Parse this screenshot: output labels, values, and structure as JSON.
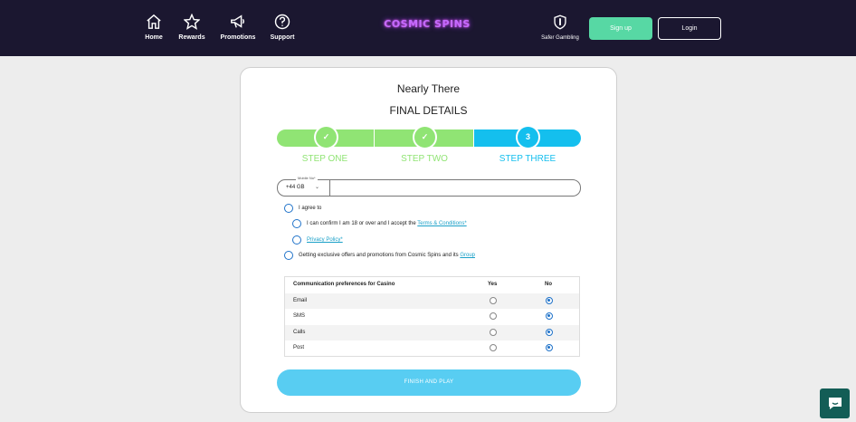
{
  "header": {
    "nav": [
      {
        "label": "Home",
        "icon": "home-icon"
      },
      {
        "label": "Rewards",
        "icon": "star-icon"
      },
      {
        "label": "Promotions",
        "icon": "megaphone-icon"
      },
      {
        "label": "Support",
        "icon": "question-icon"
      }
    ],
    "logo_text": "COSMIC SPINS",
    "safer_gambling": "Safer Gambling",
    "signup_label": "Sign up",
    "login_label": "Login"
  },
  "form": {
    "title": "Nearly There",
    "subtitle": "FINAL DETAILS",
    "steps": [
      {
        "label": "STEP ONE",
        "marker": "✓",
        "state": "done"
      },
      {
        "label": "STEP TWO",
        "marker": "✓",
        "state": "done"
      },
      {
        "label": "STEP THREE",
        "marker": "3",
        "state": "current"
      }
    ],
    "phone": {
      "float_label": "Mobile No*",
      "country_code": "+44 GB",
      "value": ""
    },
    "agree": {
      "label": "I agree to",
      "age_text": "I can confirm I am 18 or over and I accept the",
      "terms_link": "Terms & Conditions*",
      "privacy_link": "Privacy Policy*",
      "offers_text": "Getting exclusive offers and promotions from Cosmic Spins and its",
      "group_link": "Group"
    },
    "preferences": {
      "header": "Communication preferences for Casino",
      "yes": "Yes",
      "no": "No",
      "rows": [
        {
          "name": "Email",
          "selected": "No"
        },
        {
          "name": "SMS",
          "selected": "No"
        },
        {
          "name": "Calls",
          "selected": "No"
        },
        {
          "name": "Post",
          "selected": "No"
        }
      ]
    },
    "finish_label": "FINISH AND PLAY"
  },
  "colors": {
    "header_bg": "#1b1730",
    "step_done": "#90e474",
    "step_current": "#14bfee",
    "signup": "#57d8a4",
    "finish": "#58cdf2",
    "chat": "#135d56"
  }
}
